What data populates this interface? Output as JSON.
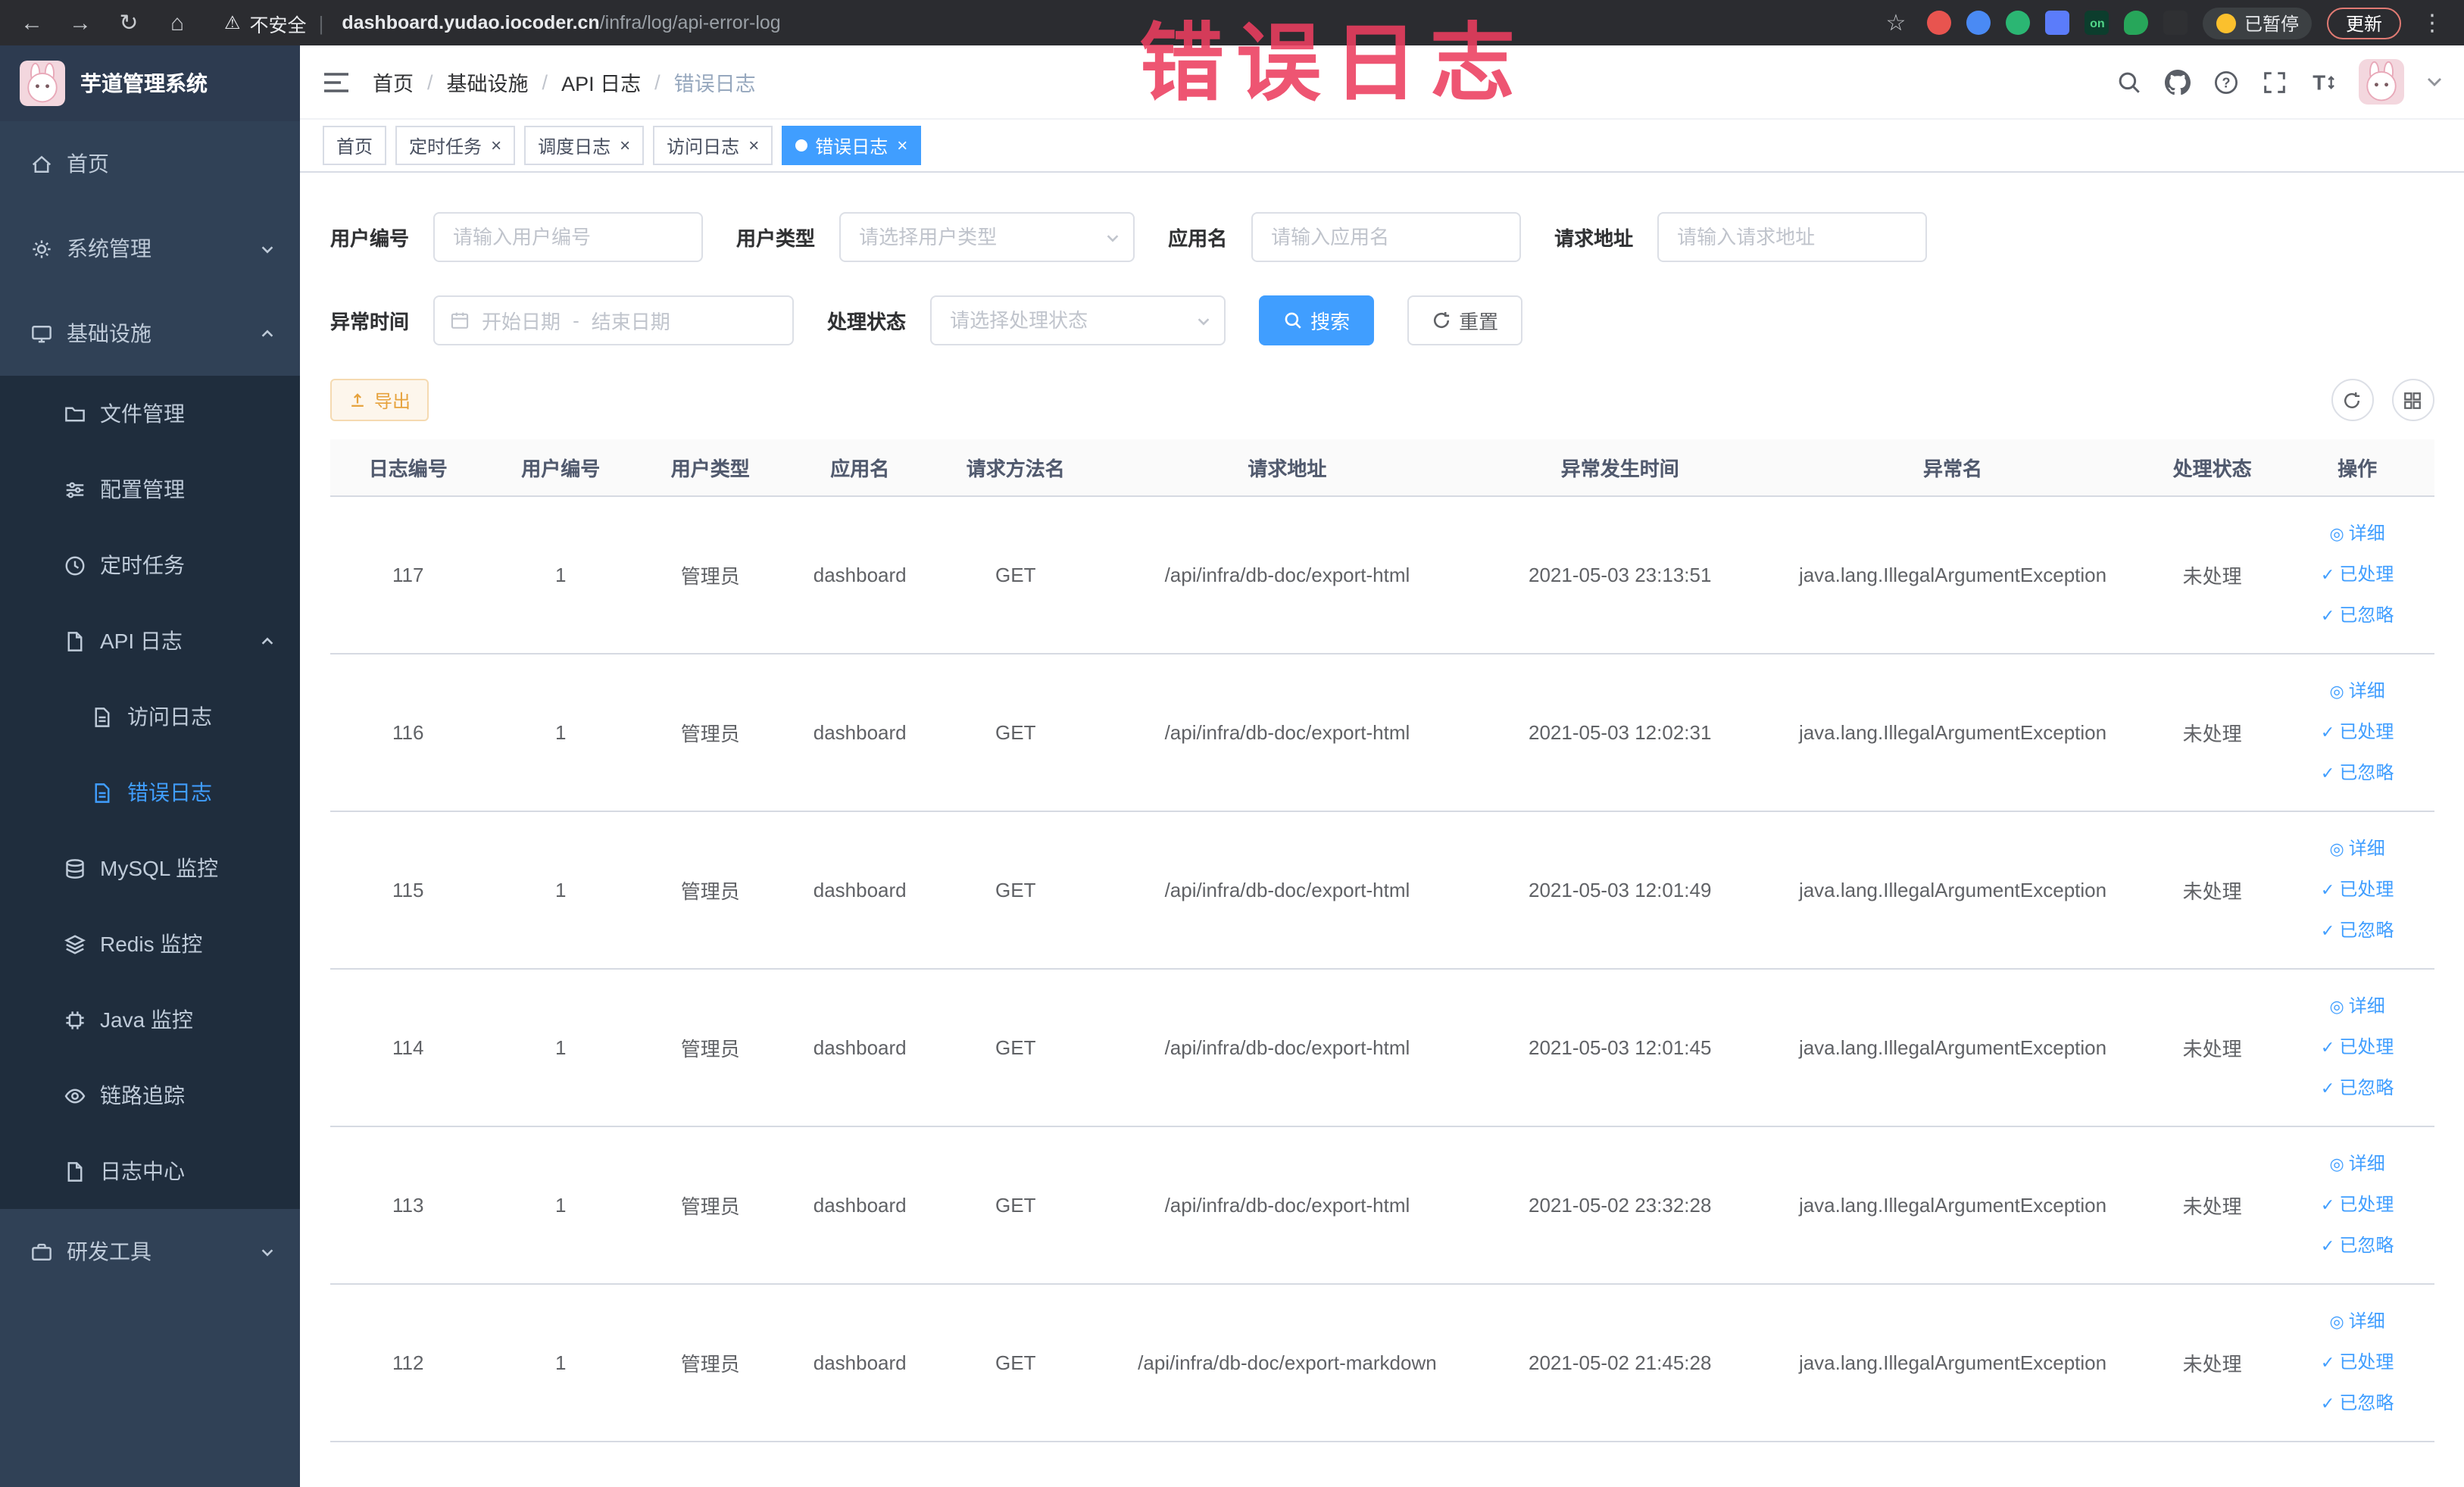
{
  "icons": {
    "back": "←",
    "forward": "→",
    "reload": "↻",
    "home": "⌂",
    "warning": "⚠",
    "divider": "|",
    "star": "☆",
    "kebab": "⋮",
    "close": "×",
    "view": "◎",
    "check": "✓"
  },
  "browser": {
    "security_label": "不安全",
    "url_domain": "dashboard.yudao.iocoder.cn",
    "url_path": "/infra/log/api-error-log",
    "ext_on_badge": "on",
    "paused_badge": "已暂停",
    "update_button": "更新"
  },
  "annotation": {
    "text": "错误日志"
  },
  "sidebar": {
    "logo_title": "芋道管理系统",
    "home": "首页",
    "system": "系统管理",
    "infra": "基础设施",
    "file": "文件管理",
    "config": "配置管理",
    "job": "定时任务",
    "api_log": "API 日志",
    "access_log": "访问日志",
    "error_log": "错误日志",
    "mysql": "MySQL 监控",
    "redis": "Redis 监控",
    "java": "Java 监控",
    "trace": "链路追踪",
    "log_center": "日志中心",
    "dev_tools": "研发工具"
  },
  "header": {
    "breadcrumbs": [
      "首页",
      "基础设施",
      "API 日志",
      "错误日志"
    ],
    "separator": "/"
  },
  "tabs": [
    {
      "label": "首页"
    },
    {
      "label": "定时任务"
    },
    {
      "label": "调度日志"
    },
    {
      "label": "访问日志"
    },
    {
      "label": "错误日志"
    }
  ],
  "filters": {
    "user_id_label": "用户编号",
    "user_id_placeholder": "请输入用户编号",
    "user_type_label": "用户类型",
    "user_type_placeholder": "请选择用户类型",
    "app_name_label": "应用名",
    "app_name_placeholder": "请输入应用名",
    "request_url_label": "请求地址",
    "request_url_placeholder": "请输入请求地址",
    "time_label": "异常时间",
    "date_start_placeholder": "开始日期",
    "date_separator": "-",
    "date_end_placeholder": "结束日期",
    "status_label": "处理状态",
    "status_placeholder": "请选择处理状态",
    "search_button": "搜索",
    "reset_button": "重置"
  },
  "toolbar": {
    "export_button": "导出"
  },
  "table": {
    "headers": [
      "日志编号",
      "用户编号",
      "用户类型",
      "应用名",
      "请求方法名",
      "请求地址",
      "异常发生时间",
      "异常名",
      "处理状态",
      "操作"
    ],
    "actions": {
      "detail": "详细",
      "processed": "已处理",
      "ignored": "已忽略"
    },
    "rows": [
      {
        "log_id": "117",
        "user_id": "1",
        "user_type": "管理员",
        "app": "dashboard",
        "method": "GET",
        "url": "/api/infra/db-doc/export-html",
        "time": "2021-05-03 23:13:51",
        "exception": "java.lang.IllegalArgumentException",
        "status": "未处理"
      },
      {
        "log_id": "116",
        "user_id": "1",
        "user_type": "管理员",
        "app": "dashboard",
        "method": "GET",
        "url": "/api/infra/db-doc/export-html",
        "time": "2021-05-03 12:02:31",
        "exception": "java.lang.IllegalArgumentException",
        "status": "未处理"
      },
      {
        "log_id": "115",
        "user_id": "1",
        "user_type": "管理员",
        "app": "dashboard",
        "method": "GET",
        "url": "/api/infra/db-doc/export-html",
        "time": "2021-05-03 12:01:49",
        "exception": "java.lang.IllegalArgumentException",
        "status": "未处理"
      },
      {
        "log_id": "114",
        "user_id": "1",
        "user_type": "管理员",
        "app": "dashboard",
        "method": "GET",
        "url": "/api/infra/db-doc/export-html",
        "time": "2021-05-03 12:01:45",
        "exception": "java.lang.IllegalArgumentException",
        "status": "未处理"
      },
      {
        "log_id": "113",
        "user_id": "1",
        "user_type": "管理员",
        "app": "dashboard",
        "method": "GET",
        "url": "/api/infra/db-doc/export-html",
        "time": "2021-05-02 23:32:28",
        "exception": "java.lang.IllegalArgumentException",
        "status": "未处理"
      },
      {
        "log_id": "112",
        "user_id": "1",
        "user_type": "管理员",
        "app": "dashboard",
        "method": "GET",
        "url": "/api/infra/db-doc/export-markdown",
        "time": "2021-05-02 21:45:28",
        "exception": "java.lang.IllegalArgumentException",
        "status": "未处理"
      }
    ]
  }
}
